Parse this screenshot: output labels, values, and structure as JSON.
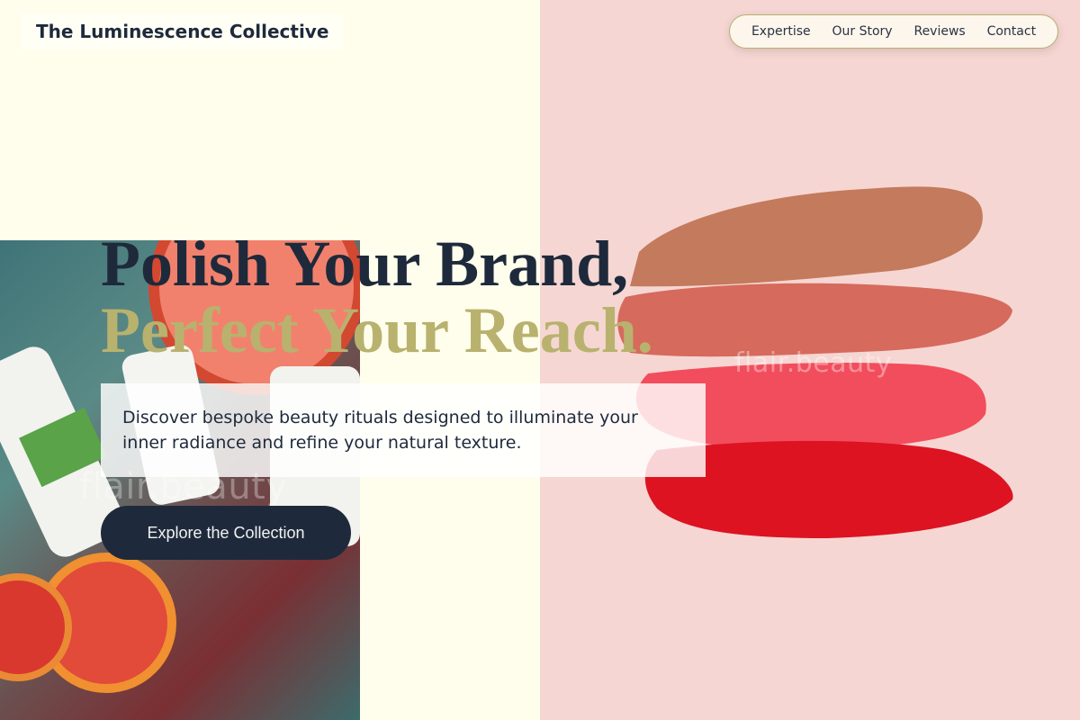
{
  "header": {
    "brand": "The Luminescence Collective",
    "nav": [
      "Expertise",
      "Our Story",
      "Reviews",
      "Contact"
    ]
  },
  "hero": {
    "headline_line1": "Polish Your Brand,",
    "headline_line2": "Perfect Your Reach.",
    "description": "Discover bespoke beauty rituals designed to illuminate your inner radiance and refine your natural texture.",
    "cta_label": "Explore the Collection"
  },
  "images": {
    "watermark": "flair.beauty"
  },
  "colors": {
    "navy": "#1e2a3b",
    "olive": "#b8b26e",
    "cream": "#fffeec",
    "blush": "#f6d6d2"
  }
}
